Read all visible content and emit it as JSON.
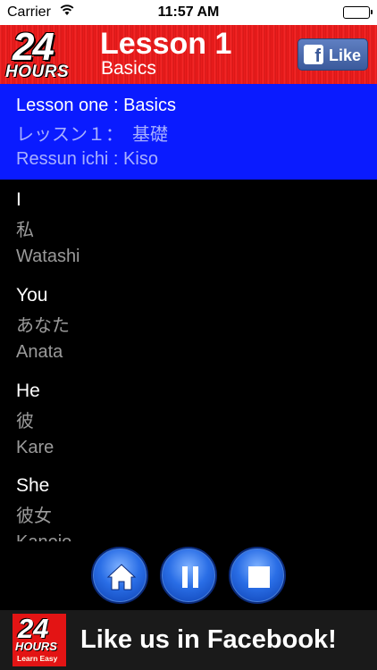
{
  "status_bar": {
    "carrier": "Carrier",
    "time": "11:57 AM"
  },
  "header": {
    "logo_number": "24",
    "logo_word": "HOURS",
    "title": "Lesson 1",
    "subtitle": "Basics",
    "like_label": "Like",
    "like_icon": "f"
  },
  "banner": {
    "english": "Lesson one : Basics",
    "japanese": "レッスン１：　基礎",
    "romaji": "Ressun ichi : Kiso"
  },
  "vocab": [
    {
      "en": "I",
      "jp": "私",
      "ro": "Watashi"
    },
    {
      "en": "You",
      "jp": "あなた",
      "ro": "Anata"
    },
    {
      "en": "He",
      "jp": "彼",
      "ro": "Kare"
    },
    {
      "en": "She",
      "jp": "彼女",
      "ro": "Kanojo"
    }
  ],
  "controls": {
    "home": "home-icon",
    "pause": "pause-icon",
    "stop": "stop-icon"
  },
  "ad": {
    "logo_number": "24",
    "logo_word": "HOURS",
    "logo_tagline": "Learn Easy",
    "text": "Like us in Facebook!"
  }
}
